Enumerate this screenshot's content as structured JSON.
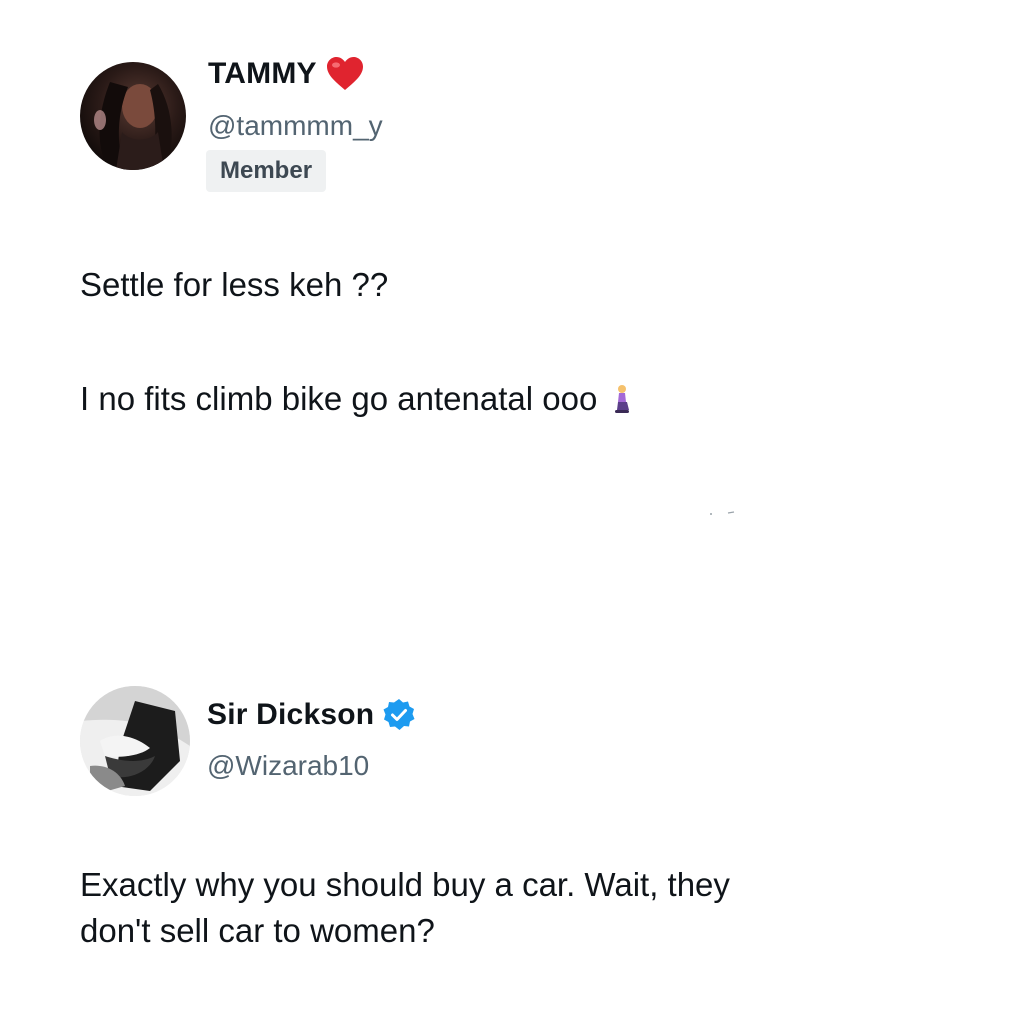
{
  "posts": [
    {
      "display_name": "TAMMY",
      "handle": "@tammmm_y",
      "badge": "Member",
      "name_icon": "red-heart-icon",
      "avatar_icon": "profile-photo-avatar",
      "lines": [
        "Settle for less keh ??",
        "I no fits climb bike go antenatal ooo"
      ],
      "trailing_emoji": "woman-kneeling-emoji"
    },
    {
      "display_name": "Sir Dickson",
      "handle": "@Wizarab10",
      "name_icon": "verified-badge-icon",
      "avatar_icon": "profile-photo-avatar",
      "lines": [
        "Exactly why you should buy a car. Wait, they",
        "don't sell car to women?"
      ]
    }
  ],
  "colors": {
    "text": "#0f1419",
    "muted": "#536471",
    "badge_bg": "#eff1f2",
    "heart": "#e0242f",
    "verified": "#1d9bf0",
    "background": "#ffffff"
  }
}
